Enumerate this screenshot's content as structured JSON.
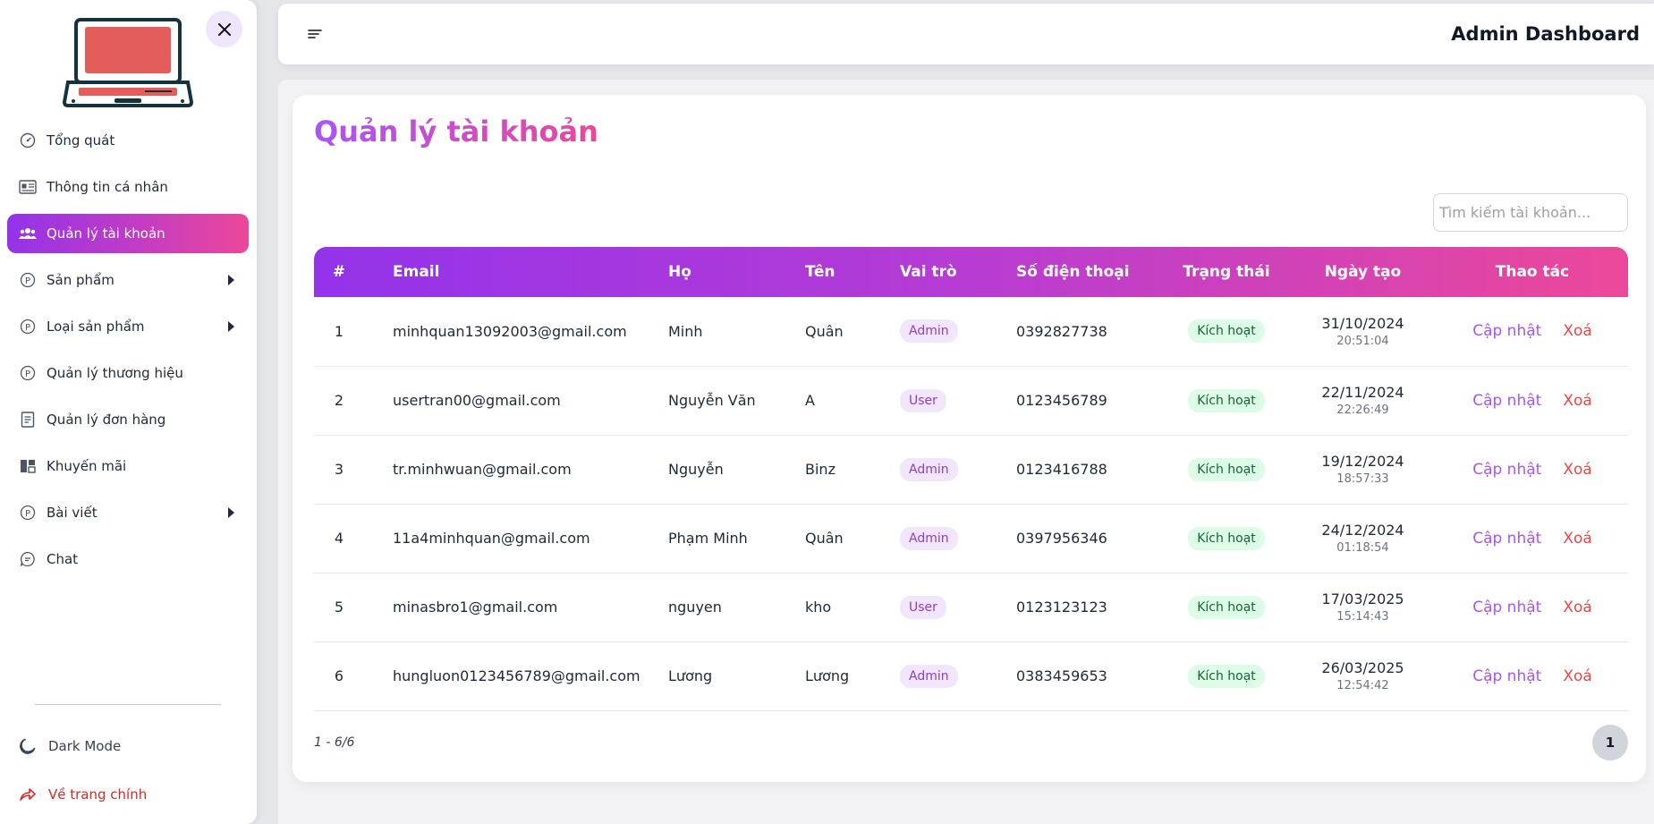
{
  "sidebar": {
    "items": [
      {
        "label": "Tổng quát",
        "icon": "dashboard-gauge-icon",
        "has_submenu": false
      },
      {
        "label": "Thông tin cá nhân",
        "icon": "id-card-icon",
        "has_submenu": false
      },
      {
        "label": "Quản lý tài khoản",
        "icon": "users-icon",
        "has_submenu": false,
        "active": true
      },
      {
        "label": "Sản phẩm",
        "icon": "p-circle-icon",
        "has_submenu": true
      },
      {
        "label": "Loại sản phẩm",
        "icon": "p-circle-icon",
        "has_submenu": true
      },
      {
        "label": "Quản lý thương hiệu",
        "icon": "p-circle-icon",
        "has_submenu": false
      },
      {
        "label": "Quản lý đơn hàng",
        "icon": "receipt-icon",
        "has_submenu": false
      },
      {
        "label": "Khuyến mãi",
        "icon": "promotion-icon",
        "has_submenu": false
      },
      {
        "label": "Bài viết",
        "icon": "p-circle-icon",
        "has_submenu": true
      },
      {
        "label": "Chat",
        "icon": "chat-bubble-icon",
        "has_submenu": false
      }
    ],
    "dark_mode_label": "Dark Mode",
    "home_label": "Về trang chính"
  },
  "header": {
    "title": "Admin Dashboard"
  },
  "main": {
    "title": "Quản lý tài khoản",
    "search_placeholder": "Tìm kiếm tài khoản...",
    "columns": [
      "#",
      "Email",
      "Họ",
      "Tên",
      "Vai trò",
      "Số điện thoại",
      "Trạng thái",
      "Ngày tạo",
      "Thao tác"
    ],
    "rows": [
      {
        "idx": "1",
        "email": "minhquan13092003@gmail.com",
        "last": "Minh",
        "first": "Quân",
        "role": "Admin",
        "phone": "0392827738",
        "status": "Kích hoạt",
        "date": "31/10/2024",
        "time": "20:51:04"
      },
      {
        "idx": "2",
        "email": "usertran00@gmail.com",
        "last": "Nguyễn Văn",
        "first": "A",
        "role": "User",
        "phone": "0123456789",
        "status": "Kích hoạt",
        "date": "22/11/2024",
        "time": "22:26:49"
      },
      {
        "idx": "3",
        "email": "tr.minhwuan@gmail.com",
        "last": "Nguyễn",
        "first": "Binz",
        "role": "Admin",
        "phone": "0123416788",
        "status": "Kích hoạt",
        "date": "19/12/2024",
        "time": "18:57:33"
      },
      {
        "idx": "4",
        "email": "11a4minhquan@gmail.com",
        "last": "Phạm Minh",
        "first": "Quân",
        "role": "Admin",
        "phone": "0397956346",
        "status": "Kích hoạt",
        "date": "24/12/2024",
        "time": "01:18:54"
      },
      {
        "idx": "5",
        "email": "minasbro1@gmail.com",
        "last": "nguyen",
        "first": "kho",
        "role": "User",
        "phone": "0123123123",
        "status": "Kích hoạt",
        "date": "17/03/2025",
        "time": "15:14:43"
      },
      {
        "idx": "6",
        "email": "hungluon0123456789@gmail.com",
        "last": "Lương",
        "first": "Lương",
        "role": "Admin",
        "phone": "0383459653",
        "status": "Kích hoạt",
        "date": "26/03/2025",
        "time": "12:54:42"
      }
    ],
    "update_label": "Cập nhật",
    "delete_label": "Xoá",
    "pagination_info": "1 - 6/6",
    "current_page": "1"
  },
  "colors": {
    "accent_start": "#9333ea",
    "accent_end": "#ec4899",
    "delete": "#ef4444",
    "status_bg": "#dcfce7"
  }
}
